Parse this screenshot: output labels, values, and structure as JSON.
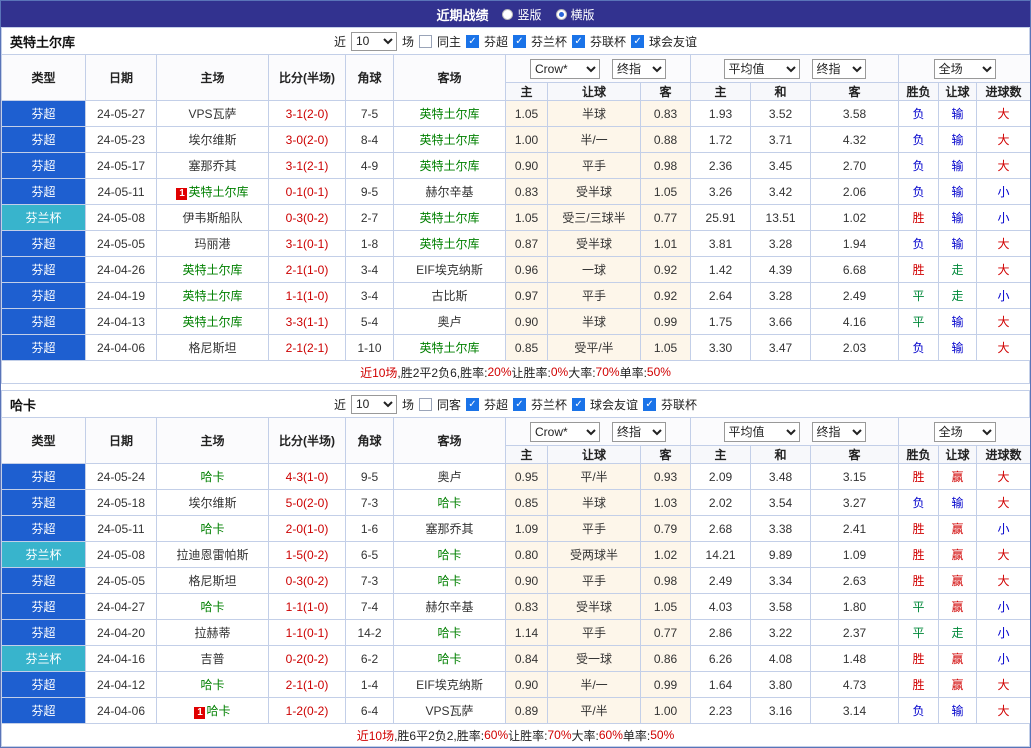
{
  "header": {
    "title": "近期战绩",
    "radios": [
      {
        "label": "竖版",
        "selected": false
      },
      {
        "label": "横版",
        "selected": true
      }
    ]
  },
  "table_headers": {
    "type": "类型",
    "date": "日期",
    "home": "主场",
    "score": "比分(半场)",
    "corner": "角球",
    "away": "客场",
    "asian_select": "Crow*",
    "asian_final": "终指",
    "euro_select": "平均值",
    "euro_final": "终指",
    "full_select": "全场",
    "sub": [
      "主",
      "让球",
      "客",
      "主",
      "和",
      "客",
      "胜负",
      "让球",
      "进球数"
    ]
  },
  "colors": {
    "topbar_bg": "#32328f",
    "league_blue": "#1e5fd0",
    "cup_cyan": "#38b4cc",
    "win_red": "#d10000",
    "draw_green": "#00883a",
    "lose_blue": "#0000cc",
    "score_red": "#cc0000",
    "subject_green": "#008000"
  },
  "sections": [
    {
      "team": "英特土尔库",
      "filter": {
        "near": "近",
        "count": "10",
        "games": "场",
        "same": "同主",
        "same_checked": false,
        "leagues": [
          "芬超",
          "芬兰杯",
          "芬联杯",
          "球会友谊"
        ]
      },
      "rows": [
        {
          "league": "芬超",
          "date": "24-05-27",
          "home": "VPS瓦萨",
          "home_subject": false,
          "home_mark": "",
          "score": "3-1(2-0)",
          "corner": "7-5",
          "away": "英特土尔库",
          "away_subject": true,
          "away_mark": "",
          "asian": [
            "1.05",
            "半球",
            "0.83"
          ],
          "euro": [
            "1.93",
            "3.52",
            "3.58"
          ],
          "result": [
            "负",
            "输",
            "大"
          ]
        },
        {
          "league": "芬超",
          "date": "24-05-23",
          "home": "埃尔维斯",
          "home_subject": false,
          "home_mark": "",
          "score": "3-0(2-0)",
          "corner": "8-4",
          "away": "英特土尔库",
          "away_subject": true,
          "away_mark": "",
          "asian": [
            "1.00",
            "半/一",
            "0.88"
          ],
          "euro": [
            "1.72",
            "3.71",
            "4.32"
          ],
          "result": [
            "负",
            "输",
            "大"
          ]
        },
        {
          "league": "芬超",
          "date": "24-05-17",
          "home": "塞那乔其",
          "home_subject": false,
          "home_mark": "",
          "score": "3-1(2-1)",
          "corner": "4-9",
          "away": "英特土尔库",
          "away_subject": true,
          "away_mark": "",
          "asian": [
            "0.90",
            "平手",
            "0.98"
          ],
          "euro": [
            "2.36",
            "3.45",
            "2.70"
          ],
          "result": [
            "负",
            "输",
            "大"
          ]
        },
        {
          "league": "芬超",
          "date": "24-05-11",
          "home": "英特土尔库",
          "home_subject": true,
          "home_mark": "1",
          "score": "0-1(0-1)",
          "corner": "9-5",
          "away": "赫尔辛基",
          "away_subject": false,
          "away_mark": "",
          "asian": [
            "0.83",
            "受半球",
            "1.05"
          ],
          "euro": [
            "3.26",
            "3.42",
            "2.06"
          ],
          "result": [
            "负",
            "输",
            "小"
          ]
        },
        {
          "league": "芬兰杯",
          "date": "24-05-08",
          "home": "伊韦斯船队",
          "home_subject": false,
          "home_mark": "",
          "score": "0-3(0-2)",
          "corner": "2-7",
          "away": "英特土尔库",
          "away_subject": true,
          "away_mark": "",
          "asian": [
            "1.05",
            "受三/三球半",
            "0.77"
          ],
          "euro": [
            "25.91",
            "13.51",
            "1.02"
          ],
          "result": [
            "胜",
            "输",
            "小"
          ]
        },
        {
          "league": "芬超",
          "date": "24-05-05",
          "home": "玛丽港",
          "home_subject": false,
          "home_mark": "",
          "score": "3-1(0-1)",
          "corner": "1-8",
          "away": "英特土尔库",
          "away_subject": true,
          "away_mark": "",
          "asian": [
            "0.87",
            "受半球",
            "1.01"
          ],
          "euro": [
            "3.81",
            "3.28",
            "1.94"
          ],
          "result": [
            "负",
            "输",
            "大"
          ]
        },
        {
          "league": "芬超",
          "date": "24-04-26",
          "home": "英特土尔库",
          "home_subject": true,
          "home_mark": "",
          "score": "2-1(1-0)",
          "corner": "3-4",
          "away": "EIF埃克纳斯",
          "away_subject": false,
          "away_mark": "",
          "asian": [
            "0.96",
            "一球",
            "0.92"
          ],
          "euro": [
            "1.42",
            "4.39",
            "6.68"
          ],
          "result": [
            "胜",
            "走",
            "大"
          ]
        },
        {
          "league": "芬超",
          "date": "24-04-19",
          "home": "英特土尔库",
          "home_subject": true,
          "home_mark": "",
          "score": "1-1(1-0)",
          "corner": "3-4",
          "away": "古比斯",
          "away_subject": false,
          "away_mark": "",
          "asian": [
            "0.97",
            "平手",
            "0.92"
          ],
          "euro": [
            "2.64",
            "3.28",
            "2.49"
          ],
          "result": [
            "平",
            "走",
            "小"
          ]
        },
        {
          "league": "芬超",
          "date": "24-04-13",
          "home": "英特土尔库",
          "home_subject": true,
          "home_mark": "",
          "score": "3-3(1-1)",
          "corner": "5-4",
          "away": "奥卢",
          "away_subject": false,
          "away_mark": "",
          "asian": [
            "0.90",
            "半球",
            "0.99"
          ],
          "euro": [
            "1.75",
            "3.66",
            "4.16"
          ],
          "result": [
            "平",
            "输",
            "大"
          ]
        },
        {
          "league": "芬超",
          "date": "24-04-06",
          "home": "格尼斯坦",
          "home_subject": false,
          "home_mark": "",
          "score": "2-1(2-1)",
          "corner": "1-10",
          "away": "英特土尔库",
          "away_subject": true,
          "away_mark": "",
          "asian": [
            "0.85",
            "受平/半",
            "1.05"
          ],
          "euro": [
            "3.30",
            "3.47",
            "2.03"
          ],
          "result": [
            "负",
            "输",
            "大"
          ]
        }
      ],
      "summary": [
        {
          "t": "近10场",
          "c": "red"
        },
        {
          "t": ",胜2平2负6, ",
          "c": ""
        },
        {
          "t": "胜率:",
          "c": ""
        },
        {
          "t": "20%",
          "c": "red"
        },
        {
          "t": " 让胜率:",
          "c": ""
        },
        {
          "t": "0%",
          "c": "red"
        },
        {
          "t": " 大率:",
          "c": ""
        },
        {
          "t": "70%",
          "c": "red"
        },
        {
          "t": " 单率:",
          "c": ""
        },
        {
          "t": "50%",
          "c": "red"
        }
      ]
    },
    {
      "team": "哈卡",
      "filter": {
        "near": "近",
        "count": "10",
        "games": "场",
        "same": "同客",
        "same_checked": false,
        "leagues": [
          "芬超",
          "芬兰杯",
          "球会友谊",
          "芬联杯"
        ]
      },
      "rows": [
        {
          "league": "芬超",
          "date": "24-05-24",
          "home": "哈卡",
          "home_subject": true,
          "home_mark": "",
          "score": "4-3(1-0)",
          "corner": "9-5",
          "away": "奥卢",
          "away_subject": false,
          "away_mark": "",
          "asian": [
            "0.95",
            "平/半",
            "0.93"
          ],
          "euro": [
            "2.09",
            "3.48",
            "3.15"
          ],
          "result": [
            "胜",
            "赢",
            "大"
          ]
        },
        {
          "league": "芬超",
          "date": "24-05-18",
          "home": "埃尔维斯",
          "home_subject": false,
          "home_mark": "",
          "score": "5-0(2-0)",
          "corner": "7-3",
          "away": "哈卡",
          "away_subject": true,
          "away_mark": "",
          "asian": [
            "0.85",
            "半球",
            "1.03"
          ],
          "euro": [
            "2.02",
            "3.54",
            "3.27"
          ],
          "result": [
            "负",
            "输",
            "大"
          ]
        },
        {
          "league": "芬超",
          "date": "24-05-11",
          "home": "哈卡",
          "home_subject": true,
          "home_mark": "",
          "score": "2-0(1-0)",
          "corner": "1-6",
          "away": "塞那乔其",
          "away_subject": false,
          "away_mark": "",
          "asian": [
            "1.09",
            "平手",
            "0.79"
          ],
          "euro": [
            "2.68",
            "3.38",
            "2.41"
          ],
          "result": [
            "胜",
            "赢",
            "小"
          ]
        },
        {
          "league": "芬兰杯",
          "date": "24-05-08",
          "home": "拉迪恩雷帕斯",
          "home_subject": false,
          "home_mark": "",
          "score": "1-5(0-2)",
          "corner": "6-5",
          "away": "哈卡",
          "away_subject": true,
          "away_mark": "",
          "asian": [
            "0.80",
            "受两球半",
            "1.02"
          ],
          "euro": [
            "14.21",
            "9.89",
            "1.09"
          ],
          "result": [
            "胜",
            "赢",
            "大"
          ]
        },
        {
          "league": "芬超",
          "date": "24-05-05",
          "home": "格尼斯坦",
          "home_subject": false,
          "home_mark": "",
          "score": "0-3(0-2)",
          "corner": "7-3",
          "away": "哈卡",
          "away_subject": true,
          "away_mark": "",
          "asian": [
            "0.90",
            "平手",
            "0.98"
          ],
          "euro": [
            "2.49",
            "3.34",
            "2.63"
          ],
          "result": [
            "胜",
            "赢",
            "大"
          ]
        },
        {
          "league": "芬超",
          "date": "24-04-27",
          "home": "哈卡",
          "home_subject": true,
          "home_mark": "",
          "score": "1-1(1-0)",
          "corner": "7-4",
          "away": "赫尔辛基",
          "away_subject": false,
          "away_mark": "",
          "asian": [
            "0.83",
            "受半球",
            "1.05"
          ],
          "euro": [
            "4.03",
            "3.58",
            "1.80"
          ],
          "result": [
            "平",
            "赢",
            "小"
          ]
        },
        {
          "league": "芬超",
          "date": "24-04-20",
          "home": "拉赫蒂",
          "home_subject": false,
          "home_mark": "",
          "score": "1-1(0-1)",
          "corner": "14-2",
          "away": "哈卡",
          "away_subject": true,
          "away_mark": "",
          "asian": [
            "1.14",
            "平手",
            "0.77"
          ],
          "euro": [
            "2.86",
            "3.22",
            "2.37"
          ],
          "result": [
            "平",
            "走",
            "小"
          ]
        },
        {
          "league": "芬兰杯",
          "date": "24-04-16",
          "home": "吉普",
          "home_subject": false,
          "home_mark": "",
          "score": "0-2(0-2)",
          "corner": "6-2",
          "away": "哈卡",
          "away_subject": true,
          "away_mark": "",
          "asian": [
            "0.84",
            "受一球",
            "0.86"
          ],
          "euro": [
            "6.26",
            "4.08",
            "1.48"
          ],
          "result": [
            "胜",
            "赢",
            "小"
          ]
        },
        {
          "league": "芬超",
          "date": "24-04-12",
          "home": "哈卡",
          "home_subject": true,
          "home_mark": "",
          "score": "2-1(1-0)",
          "corner": "1-4",
          "away": "EIF埃克纳斯",
          "away_subject": false,
          "away_mark": "",
          "asian": [
            "0.90",
            "半/一",
            "0.99"
          ],
          "euro": [
            "1.64",
            "3.80",
            "4.73"
          ],
          "result": [
            "胜",
            "赢",
            "大"
          ]
        },
        {
          "league": "芬超",
          "date": "24-04-06",
          "home": "哈卡",
          "home_subject": true,
          "home_mark": "1",
          "score": "1-2(0-2)",
          "corner": "6-4",
          "away": "VPS瓦萨",
          "away_subject": false,
          "away_mark": "",
          "asian": [
            "0.89",
            "平/半",
            "1.00"
          ],
          "euro": [
            "2.23",
            "3.16",
            "3.14"
          ],
          "result": [
            "负",
            "输",
            "大"
          ]
        }
      ],
      "summary": [
        {
          "t": "近10场",
          "c": "red"
        },
        {
          "t": ",胜6平2负2, ",
          "c": ""
        },
        {
          "t": "胜率:",
          "c": ""
        },
        {
          "t": "60%",
          "c": "red"
        },
        {
          "t": " 让胜率:",
          "c": ""
        },
        {
          "t": "70%",
          "c": "red"
        },
        {
          "t": " 大率:",
          "c": ""
        },
        {
          "t": "60%",
          "c": "red"
        },
        {
          "t": " 单率:",
          "c": ""
        },
        {
          "t": "50%",
          "c": "red"
        }
      ]
    }
  ]
}
